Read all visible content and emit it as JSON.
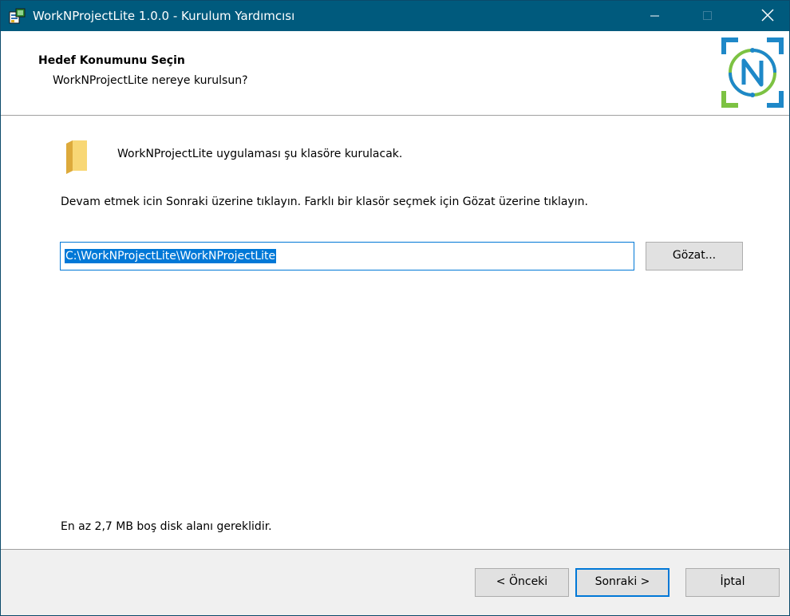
{
  "window": {
    "title": "WorkNProjectLite 1.0.0 - Kurulum Yardımcısı",
    "controls": [
      "minimize-icon",
      "maximize-icon",
      "close-icon"
    ]
  },
  "header": {
    "title": "Hedef Konumunu Seçin",
    "subtitle": "WorkNProjectLite nereye kurulsun?"
  },
  "body": {
    "folder_text": "WorkNProjectLite uygulaması şu klasöre kurulacak.",
    "instruction": "Devam etmek icin Sonraki üzerine tıklayın. Farklı bir klasör seçmek için Gözat üzerine tıklayın.",
    "path_value": "C:\\WorkNProjectLite\\WorkNProjectLite",
    "browse_label": "Gözat...",
    "disk_space": "En az 2,7 MB boş disk alanı gereklidir."
  },
  "footer": {
    "back_label": "< Önceki",
    "next_label": "Sonraki >",
    "cancel_label": "İptal"
  },
  "colors": {
    "titlebar": "#005a7d",
    "accent": "#0078d7",
    "logo_blue": "#1e88c8",
    "logo_green": "#7cc242"
  }
}
